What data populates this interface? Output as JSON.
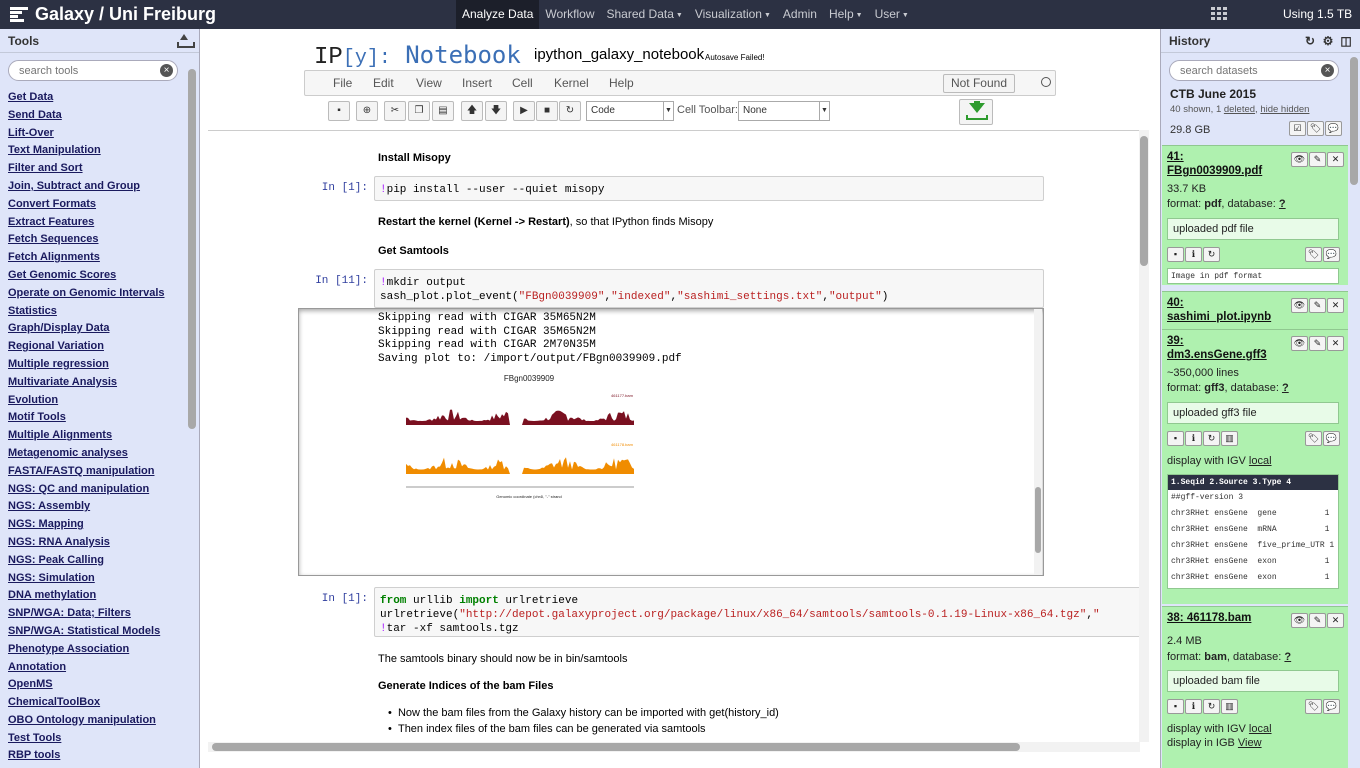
{
  "masthead": {
    "brand": "Galaxy / Uni Freiburg",
    "nav": [
      {
        "label": "Analyze Data",
        "active": true,
        "caret": false
      },
      {
        "label": "Workflow",
        "active": false,
        "caret": false
      },
      {
        "label": "Shared Data",
        "active": false,
        "caret": true
      },
      {
        "label": "Visualization",
        "active": false,
        "caret": true
      },
      {
        "label": "Admin",
        "active": false,
        "caret": false
      },
      {
        "label": "Help",
        "active": false,
        "caret": true
      },
      {
        "label": "User",
        "active": false,
        "caret": true
      }
    ],
    "quota": "Using 1.5 TB"
  },
  "tools": {
    "title": "Tools",
    "search_placeholder": "search tools",
    "items": [
      "Get Data",
      "Send Data",
      "Lift-Over",
      "Text Manipulation",
      "Filter and Sort",
      "Join, Subtract and Group",
      "Convert Formats",
      "Extract Features",
      "Fetch Sequences",
      "Fetch Alignments",
      "Get Genomic Scores",
      "Operate on Genomic Intervals",
      "Statistics",
      "Graph/Display Data",
      "Regional Variation",
      "Multiple regression",
      "Multivariate Analysis",
      "Evolution",
      "Motif Tools",
      "Multiple Alignments",
      "Metagenomic analyses",
      "FASTA/FASTQ manipulation",
      "NGS: QC and manipulation",
      "NGS: Assembly",
      "NGS: Mapping",
      "NGS: RNA Analysis",
      "NGS: Peak Calling",
      "NGS: Simulation",
      "DNA methylation",
      "SNP/WGA: Data; Filters",
      "SNP/WGA: Statistical Models",
      "Phenotype Association",
      "Annotation",
      "OpenMS",
      "ChemicalToolBox",
      "OBO Ontology manipulation",
      "Test Tools",
      "RBP tools"
    ]
  },
  "notebook": {
    "logo_ip": "IP",
    "logo_y": "[y]:",
    "logo_nb": "Notebook",
    "name": "ipython_galaxy_notebook",
    "autosave": "Autosave Failed!",
    "menu": [
      "File",
      "Edit",
      "View",
      "Insert",
      "Cell",
      "Kernel",
      "Help"
    ],
    "kernel_status": "Not Found",
    "cell_type": "Code",
    "cell_toolbar_label": "Cell Toolbar:",
    "cell_toolbar_value": "None",
    "md1": "Install Misopy",
    "p1": "In [1]:",
    "code1_bang": "!",
    "code1": "pip install --user --quiet misopy",
    "md2_b": "Restart the kernel (Kernel -> Restart)",
    "md2_rest": ", so that IPython finds Misopy",
    "md3": "Get Samtools",
    "p2": "In [11]:",
    "code2_l1a": "!",
    "code2_l1b": "mkdir output",
    "code2_l2a": "sash_plot.plot_event(",
    "code2_l2s1": "\"FBgn0039909\"",
    "code2_l2s2": "\"indexed\"",
    "code2_l2s3": "\"sashimi_settings.txt\"",
    "code2_l2s4": "\"output\"",
    "output_lines": "Skipping read with CIGAR 35M65N2M\nSkipping read with CIGAR 35M65N2M\nSkipping read with CIGAR 2M70N35M\nSaving plot to: /import/output/FBgn0039909.pdf",
    "plot_title": "FBgn0039909",
    "plot_track1": "461177.bam",
    "plot_track2": "461178.bam",
    "plot_xlabel": "Genomic coordinate (chr4l, \"-\" strand",
    "p3": "In [1]:",
    "code3_kw1": "from",
    "code3_mod": " urllib ",
    "code3_kw2": "import",
    "code3_fn": " urlretrieve",
    "code3_l2a": "urlretrieve(",
    "code3_l2s": "\"http://depot.galaxyproject.org/package/linux/x86_64/samtools/samtools-0.1.19-Linux-x86_64.tgz\"",
    "code3_l3a": "!",
    "code3_l3b": "tar -xf samtools.tgz",
    "md4": "The samtools binary should now be in bin/samtools",
    "md5": "Generate Indices of the bam Files",
    "bullet1": "Now the bam files from the Galaxy history can be imported with get(history_id)",
    "bullet2": "Then index files of the bam files can be generated via samtools"
  },
  "history": {
    "title": "History",
    "search_placeholder": "search datasets",
    "name": "CTB June 2015",
    "shown": "40 shown, 1 ",
    "deleted": "deleted",
    "sep": ", ",
    "hidden": "hide hidden",
    "size": "29.8 GB",
    "datasets": {
      "d41": {
        "title": "41: FBgn0039909.pdf",
        "size": "33.7 KB",
        "format_label": "format: ",
        "format": "pdf",
        "db_label": ", database: ",
        "db": "?",
        "info": "uploaded pdf file",
        "peek": "Image in pdf format"
      },
      "d40": {
        "title": "40: sashimi_plot.ipynb"
      },
      "d39": {
        "title": "39: dm3.ensGene.gff3",
        "lines": "~350,000 lines",
        "format_label": "format: ",
        "format": "gff3",
        "db_label": ", database: ",
        "db": "?",
        "info": "uploaded gff3 file",
        "display": "display with IGV ",
        "display_link": "local",
        "peek_header": "1.Seqid  2.Source 3.Type        4",
        "peek_rows": [
          "##gff-version 3",
          "chr3RHet ensGene  gene          1",
          "chr3RHet ensGene  mRNA          1",
          "chr3RHet ensGene  five_prime_UTR 1",
          "chr3RHet ensGene  exon          1",
          "chr3RHet ensGene  exon          1"
        ]
      },
      "d38": {
        "title": "38: 461178.bam",
        "size": "2.4 MB",
        "format_label": "format: ",
        "format": "bam",
        "db_label": ", database: ",
        "db": "?",
        "info": "uploaded bam file",
        "display": "display with IGV ",
        "display_link": "local",
        "display2": "display in IGB ",
        "display2_link": "View"
      }
    }
  },
  "colors": {
    "masthead": "#2c3143",
    "panel": "#dfe5f9",
    "dataset_ok": "#aff1af",
    "plot_track1": "#7a1020",
    "plot_track2": "#f08c00"
  }
}
